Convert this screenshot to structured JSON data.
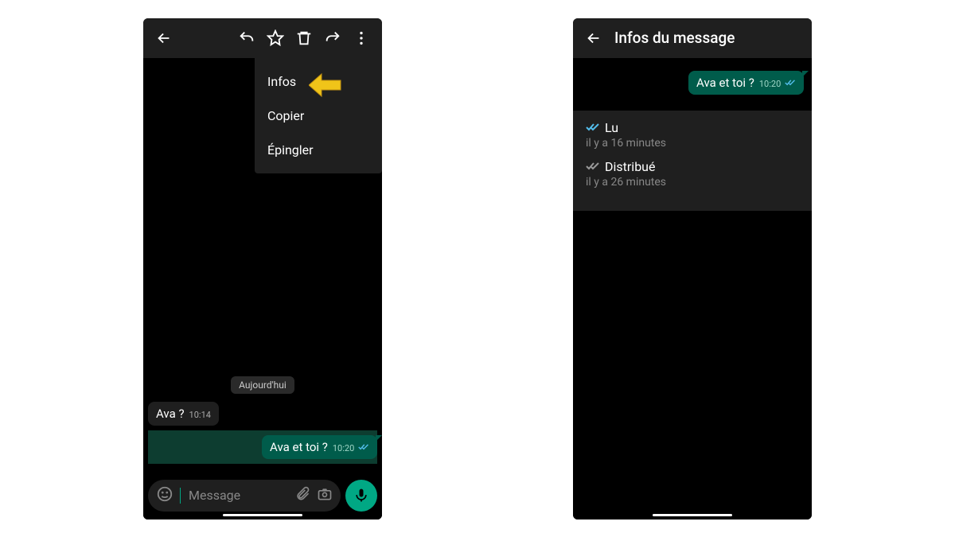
{
  "left": {
    "menu": {
      "items": [
        "Infos",
        "Copier",
        "Épingler"
      ]
    },
    "chat": {
      "date_label": "Aujourd'hui",
      "incoming": {
        "text": "Ava ?",
        "time": "10:14"
      },
      "outgoing": {
        "text": "Ava et toi ?",
        "time": "10:20"
      }
    },
    "input": {
      "placeholder": "Message"
    }
  },
  "right": {
    "title": "Infos du message",
    "message": {
      "text": "Ava et toi ?",
      "time": "10:20"
    },
    "read": {
      "label": "Lu",
      "time": "il y a 16 minutes"
    },
    "delivered": {
      "label": "Distribué",
      "time": "il y a 26 minutes"
    }
  }
}
